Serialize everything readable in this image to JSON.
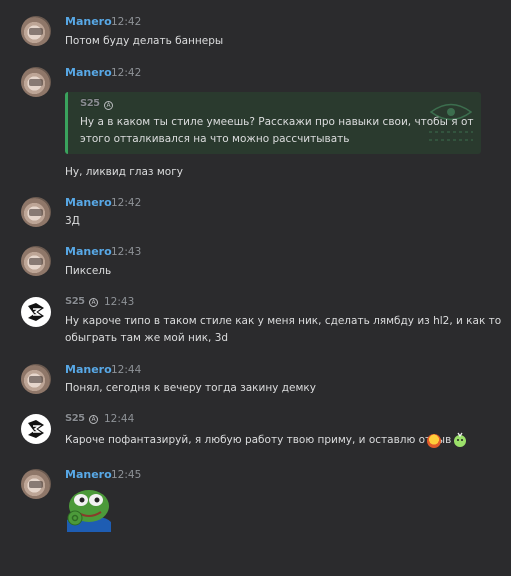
{
  "users": {
    "manero": "Manero",
    "s25": "S25"
  },
  "messages": [
    {
      "time": "12:42",
      "text": "Потом буду делать баннеры"
    },
    {
      "time": "12:42",
      "quote_line1": "Ну а в каком ты стиле умеешь? Расскажи про навыки свои, чтобы я от",
      "quote_line2": "этого отталкивался на что можно рассчитывать",
      "text": "Ну, ликвид глаз могу"
    },
    {
      "time": "12:42",
      "text": "3Д"
    },
    {
      "time": "12:43",
      "text": "Пиксель"
    },
    {
      "time": "12:43",
      "line1": "Ну кароче типо в таком стиле как у меня ник, сделать лямбду из hl2, и как то",
      "line2": "обыграть там же мой ник, 3d"
    },
    {
      "time": "12:44",
      "text": "Понял, сегодня к вечеру тогда закину демку"
    },
    {
      "time": "12:44",
      "text": "Кароче пофантазируй, я любую работу твою приму, и оставлю отзыв"
    },
    {
      "time": "12:45"
    }
  ],
  "colors": {
    "background": "#2b2b2d",
    "manero_name": "#58a8e6",
    "quote_border": "#3aa25d"
  },
  "icons": {
    "emoji_1": "fire-face-emoji",
    "emoji_2": "cute-emoji",
    "sticker": "pepe-ok-sticker"
  }
}
